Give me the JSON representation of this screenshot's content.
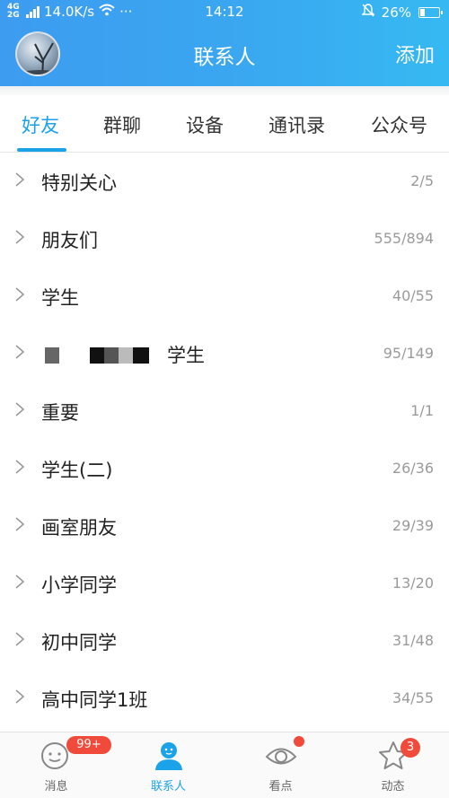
{
  "status_bar": {
    "network": "4G 2G",
    "speed": "14.0K/s",
    "more": "···",
    "time": "14:12",
    "battery": "26%",
    "battery_level": 0.26
  },
  "header": {
    "title": "联系人",
    "add_label": "添加"
  },
  "tabs": [
    {
      "label": "好友",
      "active": true
    },
    {
      "label": "群聊",
      "active": false
    },
    {
      "label": "设备",
      "active": false
    },
    {
      "label": "通讯录",
      "active": false
    },
    {
      "label": "公众号",
      "active": false
    }
  ],
  "groups": [
    {
      "name": "特别关心",
      "count": "2/5"
    },
    {
      "name": "朋友们",
      "count": "555/894"
    },
    {
      "name": "学生",
      "count": "40/55"
    },
    {
      "name": "学生",
      "count": "95/149",
      "redacted": true
    },
    {
      "name": "重要",
      "count": "1/1"
    },
    {
      "name": "学生(二)",
      "count": "26/36"
    },
    {
      "name": "画室朋友",
      "count": "29/39"
    },
    {
      "name": "小学同学",
      "count": "13/20"
    },
    {
      "name": "初中同学",
      "count": "31/48"
    },
    {
      "name": "高中同学1班",
      "count": "34/55"
    }
  ],
  "bottom_nav": [
    {
      "label": "消息",
      "icon": "message-face-icon",
      "badge": "99+"
    },
    {
      "label": "联系人",
      "icon": "contacts-person-icon",
      "active": true
    },
    {
      "label": "看点",
      "icon": "eye-icon",
      "dot": true
    },
    {
      "label": "动态",
      "icon": "star-icon",
      "badge": "3"
    }
  ],
  "colors": {
    "accent": "#1aa3e8",
    "header_start": "#3d9cf0",
    "header_end": "#36b9f2",
    "badge": "#f04b3a"
  }
}
